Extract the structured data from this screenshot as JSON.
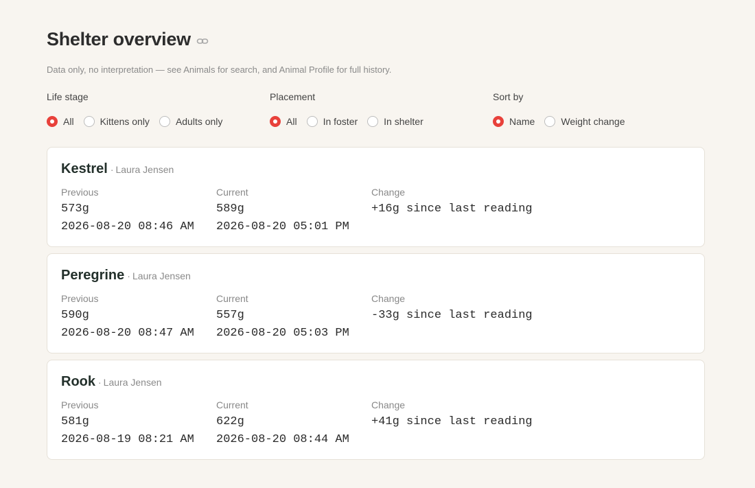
{
  "header": {
    "title": "Shelter overview",
    "subtitle": "Data only, no interpretation — see Animals for search, and Animal Profile for full history."
  },
  "filters": {
    "life_stage": {
      "label": "Life stage",
      "options": [
        {
          "label": "All",
          "checked": true
        },
        {
          "label": "Kittens only",
          "checked": false
        },
        {
          "label": "Adults only",
          "checked": false
        }
      ]
    },
    "placement": {
      "label": "Placement",
      "options": [
        {
          "label": "All",
          "checked": true
        },
        {
          "label": "In foster",
          "checked": false
        },
        {
          "label": "In shelter",
          "checked": false
        }
      ]
    },
    "sort_by": {
      "label": "Sort by",
      "options": [
        {
          "label": "Name",
          "checked": true
        },
        {
          "label": "Weight change",
          "checked": false
        }
      ]
    }
  },
  "columns": {
    "previous": "Previous",
    "current": "Current",
    "change": "Change"
  },
  "animals": [
    {
      "name": "Kestrel",
      "separator": "·",
      "caretaker": "Laura Jensen",
      "previous_weight": "573g",
      "previous_time": "2026-08-20 08:46 AM",
      "current_weight": "589g",
      "current_time": "2026-08-20 05:01 PM",
      "change": "+16g since last reading"
    },
    {
      "name": "Peregrine",
      "separator": "·",
      "caretaker": "Laura Jensen",
      "previous_weight": "590g",
      "previous_time": "2026-08-20 08:47 AM",
      "current_weight": "557g",
      "current_time": "2026-08-20 05:03 PM",
      "change": "-33g since last reading"
    },
    {
      "name": "Rook",
      "separator": "·",
      "caretaker": "Laura Jensen",
      "previous_weight": "581g",
      "previous_time": "2026-08-19 08:21 AM",
      "current_weight": "622g",
      "current_time": "2026-08-20 08:44 AM",
      "change": "+41g since last reading"
    }
  ],
  "colors": {
    "accent": "#e8413b",
    "background": "#f8f5f0",
    "card": "#ffffff"
  },
  "icons": {
    "title_link": "link-icon"
  }
}
